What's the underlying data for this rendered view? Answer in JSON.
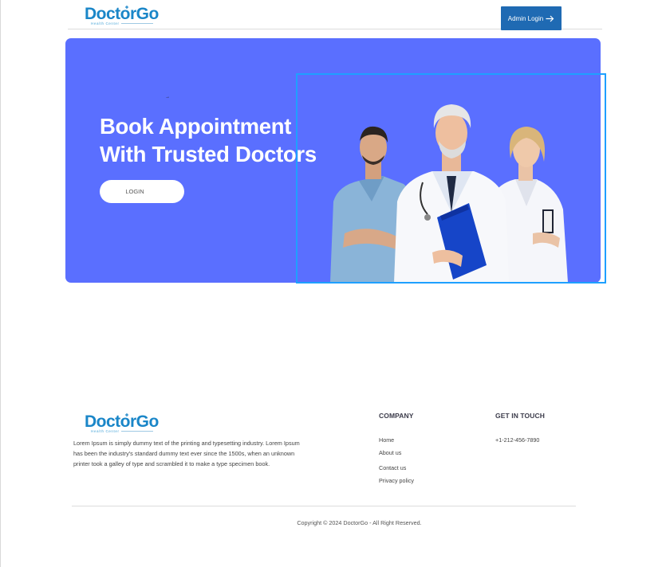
{
  "header": {
    "logo_text": "DoctorGo",
    "logo_tagline": "Health Center",
    "admin_button_label": "Admin Login",
    "admin_button_icon": "arrow-right-icon"
  },
  "hero": {
    "small_arrow": "→",
    "title_line1": "Book Appointment",
    "title_line2": "With Trusted Doctors",
    "login_button_label": "LOGIN",
    "background_color": "#5a6fff",
    "image": "three-doctors-image"
  },
  "footer": {
    "logo_text": "DoctorGo",
    "logo_tagline": "Health Center",
    "description": "Lorem Ipsum is simply dummy text of the printing and typesetting industry. Lorem Ipsum has been the industry's standard dummy text ever since the 1500s, when an unknown printer took a galley of type and scrambled it to make a type specimen book.",
    "company": {
      "title": "COMPANY",
      "links": [
        "Home",
        "About us",
        "Contact us",
        "Privacy policy"
      ]
    },
    "contact": {
      "title": "GET IN TOUCH",
      "phone": "+1-212-456-7890"
    },
    "copyright": "Copyright © 2024 DoctorGo - All Right Reserved."
  },
  "colors": {
    "brand_blue": "#1a86c8",
    "button_blue": "#1f6ab3",
    "hero_purple": "#5a6fff",
    "selection_outline": "#1ea0ff"
  }
}
